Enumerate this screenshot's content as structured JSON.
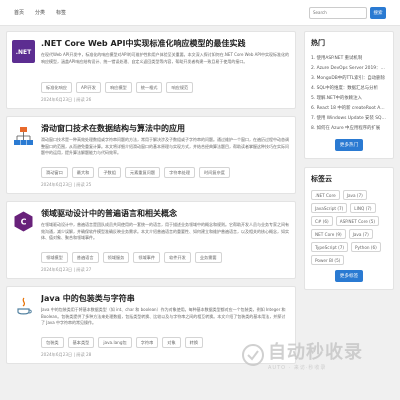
{
  "nav": {
    "items": [
      "首页",
      "分类",
      "标签"
    ]
  },
  "search": {
    "placeholder": "Search",
    "button": "搜索"
  },
  "posts": [
    {
      "title": ".NET Core Web API中实现标准化响应模型的最佳实践",
      "excerpt": "在现代Web API开发中，标准化的响应模型对API的可维护性和用户体验至关重要。本文深入探讨如何在.NET Core Web API中实现标准化的响应模型，涵盖API响应结构设计、统一错误处理、自定义返回类型等内容，帮助开发者构建一致且易于使用的接口。",
      "tags": [
        "标准化响应",
        "API开发",
        "响应模型",
        "统一格式",
        "响应规范"
      ],
      "meta": "2024年6月23日 | 阅读 26",
      "thumb": "net"
    },
    {
      "title": "滑动窗口技术在数据结构与算法中的应用",
      "excerpt": "滑动窗口技术是一种高效处理数组或字符串问题的方法，常用于解决涉及子数组或子字符串的问题。通过维护一个窗口，在遍历过程中动态调整窗口的范围，从而避免重复计算。本文将详细介绍滑动窗口的基本原理与实现方式，并结合经典算法题目，帮助读者掌握这种技巧在实际问题中的运用，提升算法解题能力与代码效率。",
      "tags": [
        "滑动窗口",
        "最大和",
        "子数组",
        "元素重复问题",
        "字符串处理",
        "时间复杂度"
      ],
      "meta": "2024年6月23日 | 阅读 25",
      "thumb": "algo"
    },
    {
      "title": "领域驱动设计中的普遍语言和相关概念",
      "excerpt": "在领域驱动设计中，普遍语言是团队成员共同使用的一套统一的语言，用于描述业务领域中的概念和规则。它帮助开发人员与业务专家之间有效沟通，减少误解，并确保软件模型准确反映业务需求。本文介绍普遍语言的重要性、如何建立和维护普遍语言，以及相关的核心概念，如实体、值对象、聚合和领域事件。",
      "tags": [
        "领域模型",
        "普遍语言",
        "领域服务",
        "领域事件",
        "软件开发",
        "业务需要"
      ],
      "meta": "2024年6月23日 | 阅读 27",
      "thumb": "ddd"
    },
    {
      "title": "Java 中的包装类与字符串",
      "excerpt": "Java 中的包装类用于将基本数据类型（如 int、char 和 boolean）作为对象使用。每种基本数据类型都对应一个包装类，例如 Integer 和 Boolean。包装类提供了多种方法来处理数据，包括类型转换、比较以及与字符串之间的相互转换。本文介绍了包装类的基本用法，并探讨了 Java 中字符串的常见操作。",
      "tags": [
        "包装类",
        "基本类型",
        "java.lang包",
        "字符串",
        "对象",
        "转换"
      ],
      "meta": "2024年6月23日 | 阅读 28",
      "thumb": "java"
    }
  ],
  "sidebar": {
    "hot_title": "热门",
    "hot_items": [
      "1. 使用ASP.NET 重试机制",
      "2. Azure DevOps Server 2019：在本地部署",
      "3. MongoDB中的TTL索引：自动删除",
      "4. SQL中的维度：数据汇总与分析",
      "5. 理解.NET中的依赖注入",
      "6. React 18 中的新 createRoot API：",
      "7. 使用 Windows Update 安装 SQL Server",
      "8. 如何在 Azure 中应用程序的扩展"
    ],
    "hot_more": "更多热门",
    "tags_title": "标签云",
    "cloud_tags": [
      ".NET Core",
      "Java (7)",
      "JavaScript (7)",
      "LINQ (7)",
      "C# (6)",
      "ASP.NET Core (5)",
      "NET Core (9)",
      "Java (7)",
      "TypeScript (7)",
      "Python (6)",
      "Power BI (5)"
    ],
    "tags_more": "更多标签"
  },
  "watermark": {
    "big": "自动秒收录",
    "small": "AUTO · 来访·秒收录"
  }
}
